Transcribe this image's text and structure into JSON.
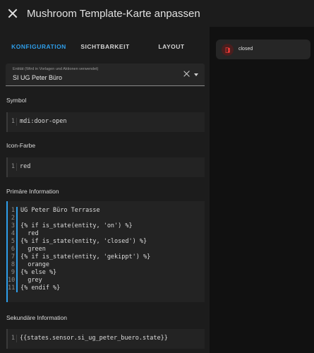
{
  "header": {
    "title": "Mushroom Template-Karte anpassen"
  },
  "tabs": [
    {
      "label": "KONFIGURATION",
      "active": true
    },
    {
      "label": "SICHTBARKEIT",
      "active": false
    },
    {
      "label": "LAYOUT",
      "active": false
    }
  ],
  "entity": {
    "label": "Entität (Wird in Vorlagen und Aktionen verwendet)",
    "value": "SI UG Peter Büro"
  },
  "symbol": {
    "label": "Symbol",
    "lines": [
      "mdi:door-open"
    ]
  },
  "icon_color": {
    "label": "Icon-Farbe",
    "lines": [
      "red"
    ]
  },
  "primary": {
    "label": "Primäre Information",
    "lines": [
      "UG Peter Büro Terrasse",
      "",
      "{% if is_state(entity, 'on') %}",
      "  red",
      "{% if is_state(entity, 'closed') %}",
      "  green",
      "{% if is_state(entity, 'gekippt') %}",
      "  orange",
      "{% else %}",
      "  grey",
      "{% endif %}"
    ]
  },
  "secondary": {
    "label": "Sekundäre Information",
    "lines": [
      "{{states.sensor.si_ug_peter_buero.state}}"
    ]
  },
  "preview_card": {
    "state": "closed",
    "icon": "door-open-icon",
    "icon_color": "#e53935"
  },
  "colors": {
    "accent": "#2e9eea",
    "background": "#111111",
    "panel": "#1c1c1c",
    "jinja": "#cf6ea5"
  }
}
